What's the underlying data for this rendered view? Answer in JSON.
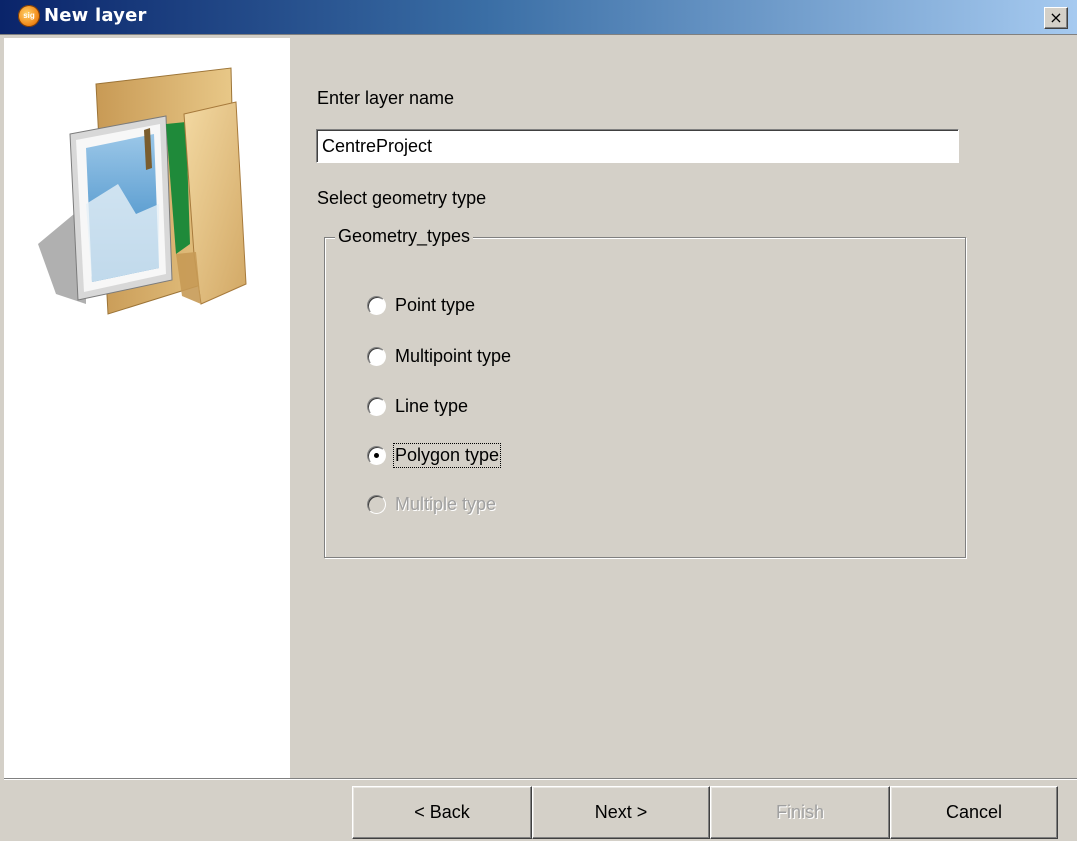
{
  "window": {
    "title": "New layer",
    "app_icon_text": "sig",
    "close_label": "×"
  },
  "form": {
    "layer_name_label": "Enter layer name",
    "layer_name_value": "CentreProject",
    "geometry_label": "Select geometry type",
    "group_title": "Geometry_types",
    "options": [
      {
        "label": "Point type",
        "selected": false,
        "enabled": true
      },
      {
        "label": "Multipoint type",
        "selected": false,
        "enabled": true
      },
      {
        "label": "Line type",
        "selected": false,
        "enabled": true
      },
      {
        "label": "Polygon type",
        "selected": true,
        "enabled": true
      },
      {
        "label": "Multiple type",
        "selected": false,
        "enabled": false
      }
    ]
  },
  "buttons": {
    "back": "< Back",
    "next": "Next >",
    "finish": "Finish",
    "cancel": "Cancel"
  },
  "colors": {
    "dialog_bg": "#d4d0c8",
    "titlebar_start": "#0a246a",
    "titlebar_end": "#a6caf0"
  },
  "icons": {
    "app": "app-logo-icon",
    "close": "close-icon",
    "illustration": "folder-with-map-icon"
  }
}
